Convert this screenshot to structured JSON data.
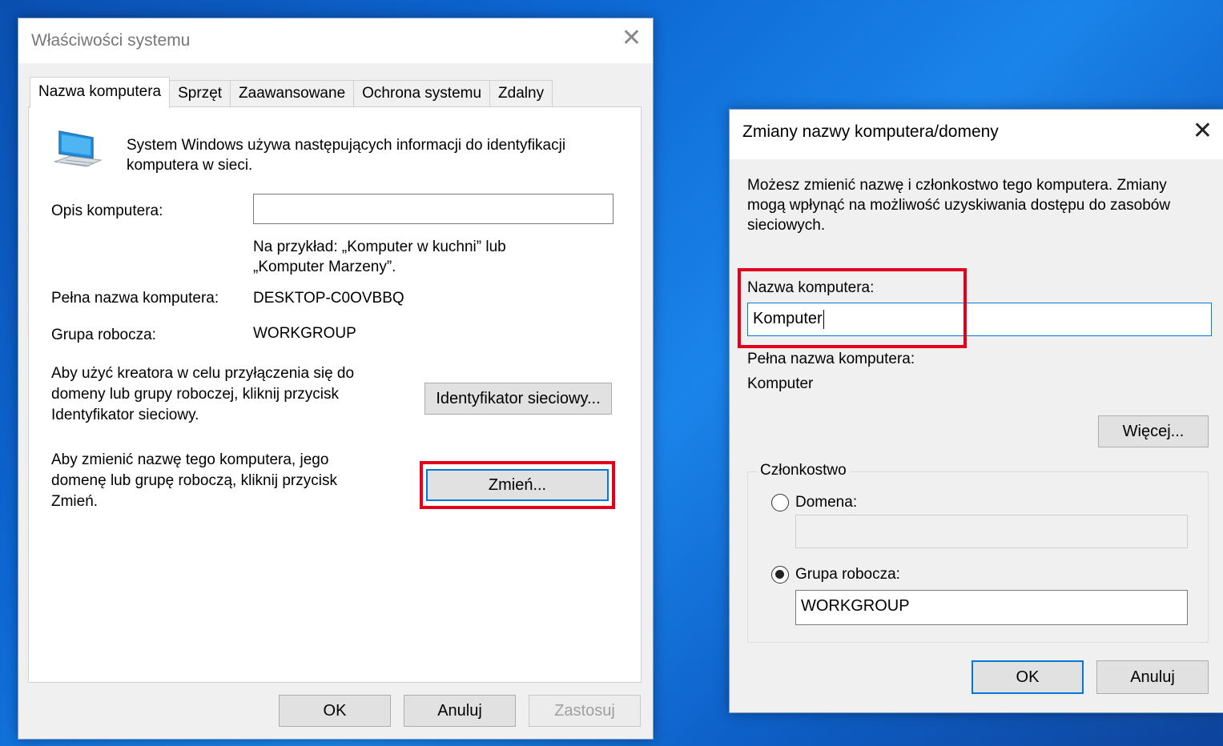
{
  "system_properties": {
    "title": "Właściwości systemu",
    "tabs": [
      "Nazwa komputera",
      "Sprzęt",
      "Zaawansowane",
      "Ochrona systemu",
      "Zdalny"
    ],
    "info_line1": "System Windows używa następujących informacji do identyfikacji",
    "info_line2": "komputera w sieci.",
    "description_label": "Opis komputera:",
    "description_value": "",
    "example_line1": "Na przykład: „Komputer w kuchni” lub",
    "example_line2": "„Komputer Marzeny”.",
    "full_name_label": "Pełna nazwa komputera:",
    "full_name_value": "DESKTOP-C0OVBBQ",
    "workgroup_label": "Grupa robocza:",
    "workgroup_value": "WORKGROUP",
    "network_id_text1": "Aby użyć kreatora w celu przyłączenia się do",
    "network_id_text2": "domeny lub grupy roboczej, kliknij przycisk",
    "network_id_text3": "Identyfikator sieciowy.",
    "network_id_button": "Identyfikator sieciowy...",
    "rename_text1": "Aby zmienić nazwę tego komputera, jego",
    "rename_text2": "domenę lub grupę roboczą, kliknij przycisk",
    "rename_text3": "Zmień.",
    "change_button": "Zmień...",
    "ok_button": "OK",
    "cancel_button": "Anuluj",
    "apply_button": "Zastosuj"
  },
  "rename_dialog": {
    "title": "Zmiany nazwy komputera/domeny",
    "intro_line1": "Możesz zmienić nazwę i członkostwo tego komputera. Zmiany",
    "intro_line2": "mogą wpłynąć na możliwość uzyskiwania dostępu do zasobów",
    "intro_line3": "sieciowych.",
    "computer_name_label": "Nazwa komputera:",
    "computer_name_value": "Komputer",
    "full_name_label": "Pełna nazwa komputera:",
    "full_name_value": "Komputer",
    "more_button": "Więcej...",
    "membership_label": "Członkostwo",
    "domain_label": "Domena:",
    "domain_value": "",
    "workgroup_label": "Grupa robocza:",
    "workgroup_value": "WORKGROUP",
    "selected_membership": "workgroup",
    "ok_button": "OK",
    "cancel_button": "Anuluj"
  },
  "colors": {
    "highlight_box": "#e2001a",
    "focus_blue": "#0078d7",
    "desktop_blue": "#0d67d3"
  },
  "icons": [
    "computer-icon",
    "close-icon",
    "radio-button"
  ]
}
